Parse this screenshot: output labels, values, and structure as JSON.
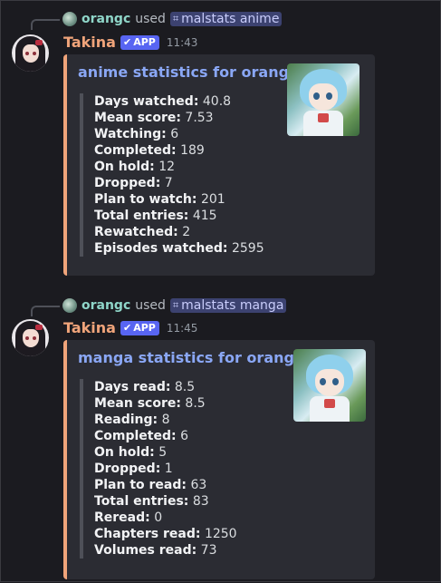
{
  "messages": [
    {
      "reply": {
        "user": "orangc",
        "used": "used",
        "command": "malstats anime"
      },
      "author": "Takina",
      "app_badge": "APP",
      "time": "11:43",
      "embed": {
        "title": "anime statistics for orangc",
        "accent": "#f0a47a",
        "fields": [
          {
            "label": "Days watched:",
            "value": "40.8"
          },
          {
            "label": "Mean score:",
            "value": "7.53"
          },
          {
            "label": "Watching:",
            "value": "6"
          },
          {
            "label": "Completed:",
            "value": "189"
          },
          {
            "label": "On hold:",
            "value": "12"
          },
          {
            "label": "Dropped:",
            "value": "7"
          },
          {
            "label": "Plan to watch:",
            "value": "201"
          },
          {
            "label": "Total entries:",
            "value": "415"
          },
          {
            "label": "Rewatched:",
            "value": "2"
          },
          {
            "label": "Episodes watched:",
            "value": "2595"
          }
        ]
      }
    },
    {
      "reply": {
        "user": "orangc",
        "used": "used",
        "command": "malstats manga"
      },
      "author": "Takina",
      "app_badge": "APP",
      "time": "11:45",
      "embed": {
        "title": "manga statistics for orangc",
        "accent": "#f0a47a",
        "fields": [
          {
            "label": "Days read:",
            "value": "8.5"
          },
          {
            "label": "Mean score:",
            "value": "8.5"
          },
          {
            "label": "Reading:",
            "value": "8"
          },
          {
            "label": "Completed:",
            "value": "6"
          },
          {
            "label": "On hold:",
            "value": "5"
          },
          {
            "label": "Dropped:",
            "value": "1"
          },
          {
            "label": "Plan to read:",
            "value": "63"
          },
          {
            "label": "Total entries:",
            "value": "83"
          },
          {
            "label": "Reread:",
            "value": "0"
          },
          {
            "label": "Chapters read:",
            "value": "1250"
          },
          {
            "label": "Volumes read:",
            "value": "73"
          }
        ]
      }
    }
  ],
  "icons": {
    "slash_command": "slash-command-icon",
    "verified": "check-icon"
  }
}
